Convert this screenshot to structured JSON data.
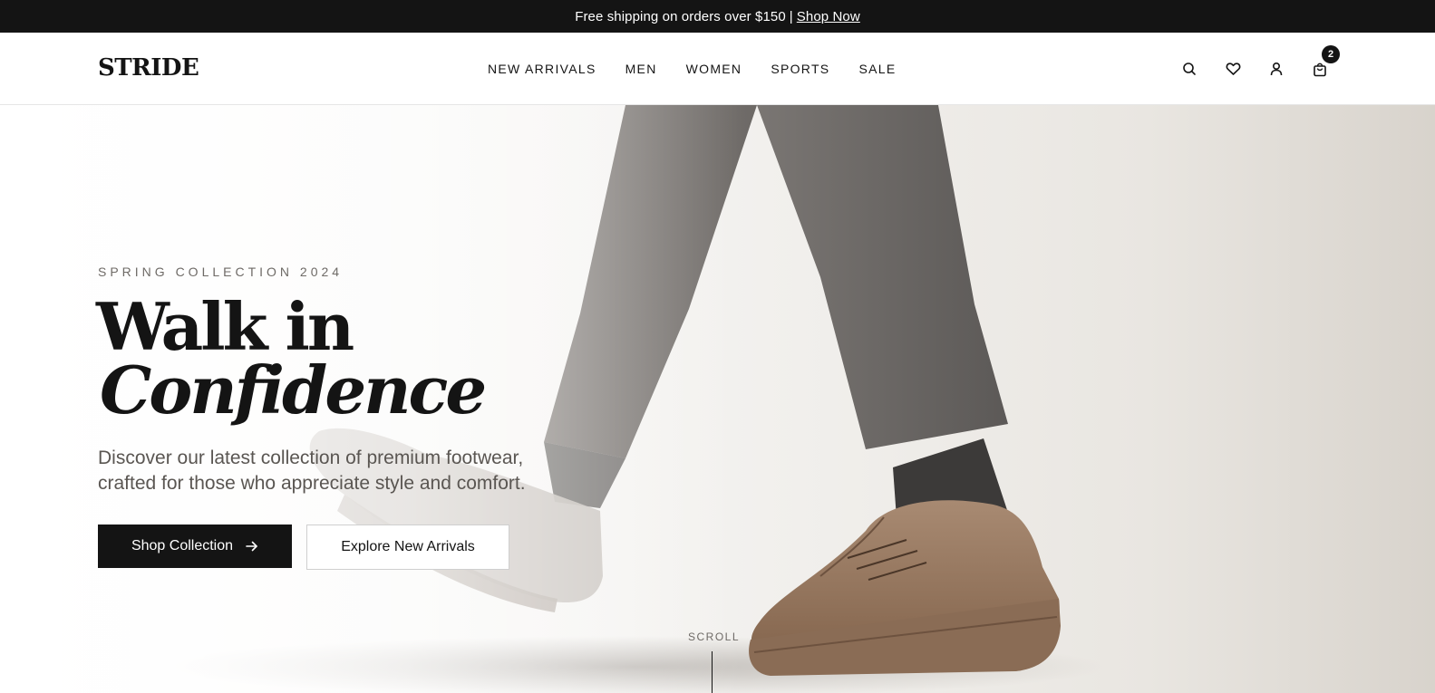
{
  "announcement": {
    "text": "Free shipping on orders over $150",
    "separator": "|",
    "link_label": "Shop Now"
  },
  "header": {
    "logo": "STRIDE",
    "nav": [
      {
        "label": "NEW ARRIVALS"
      },
      {
        "label": "MEN"
      },
      {
        "label": "WOMEN"
      },
      {
        "label": "SPORTS"
      },
      {
        "label": "SALE"
      }
    ],
    "icons": [
      "search-icon",
      "heart-icon",
      "user-icon",
      "cart-icon"
    ],
    "cart_count": "2"
  },
  "hero": {
    "eyebrow": "SPRING COLLECTION 2024",
    "headline_line1": "Walk in",
    "headline_line2": "Confidence",
    "subtext": "Discover our latest collection of premium footwear, crafted for those who appreciate style and comfort.",
    "primary_button": "Shop Collection",
    "secondary_button": "Explore New Arrivals",
    "scroll_label": "SCROLL"
  },
  "colors": {
    "ink": "#141414",
    "muted": "#6e6a66",
    "shoe_leather": "#9b7a60"
  }
}
